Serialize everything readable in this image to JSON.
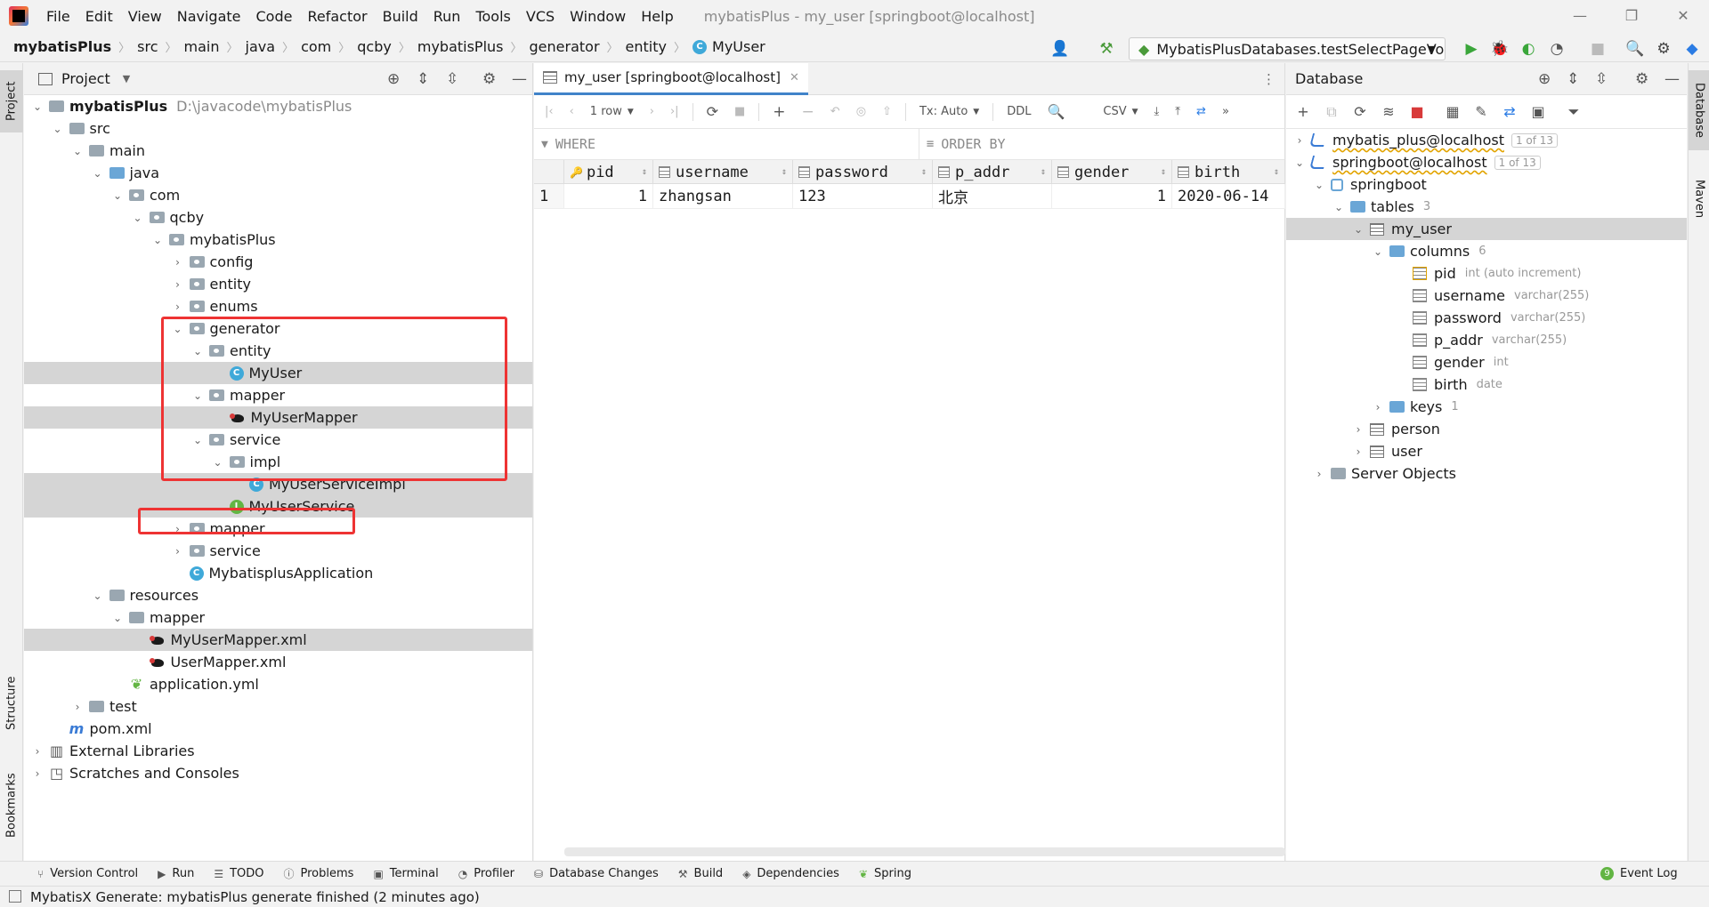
{
  "menu": [
    "File",
    "Edit",
    "View",
    "Navigate",
    "Code",
    "Refactor",
    "Build",
    "Run",
    "Tools",
    "VCS",
    "Window",
    "Help"
  ],
  "window_title": "mybatisPlus - my_user [springboot@localhost]",
  "breadcrumb": [
    "mybatisPlus",
    "src",
    "main",
    "java",
    "com",
    "qcby",
    "mybatisPlus",
    "generator",
    "entity",
    "MyUser"
  ],
  "run_config": "MybatisPlusDatabases.testSelectPageVo",
  "project": {
    "title": "Project",
    "tree": [
      {
        "label": "mybatisPlus",
        "extra": "D:\\javacode\\mybatisPlus",
        "depth": 0,
        "icon": "folder",
        "arrow": "down",
        "bold": true
      },
      {
        "label": "src",
        "depth": 1,
        "icon": "folder",
        "arrow": "down"
      },
      {
        "label": "main",
        "depth": 2,
        "icon": "folder",
        "arrow": "down"
      },
      {
        "label": "java",
        "depth": 3,
        "icon": "folder-blue",
        "arrow": "down"
      },
      {
        "label": "com",
        "depth": 4,
        "icon": "package",
        "arrow": "down"
      },
      {
        "label": "qcby",
        "depth": 5,
        "icon": "package",
        "arrow": "down"
      },
      {
        "label": "mybatisPlus",
        "depth": 6,
        "icon": "package",
        "arrow": "down"
      },
      {
        "label": "config",
        "depth": 7,
        "icon": "package",
        "arrow": "right"
      },
      {
        "label": "entity",
        "depth": 7,
        "icon": "package",
        "arrow": "right"
      },
      {
        "label": "enums",
        "depth": 7,
        "icon": "package",
        "arrow": "right"
      },
      {
        "label": "generator",
        "depth": 7,
        "icon": "package",
        "arrow": "down"
      },
      {
        "label": "entity",
        "depth": 8,
        "icon": "package",
        "arrow": "down"
      },
      {
        "label": "MyUser",
        "depth": 9,
        "icon": "class",
        "arrow": "none",
        "selected": true
      },
      {
        "label": "mapper",
        "depth": 8,
        "icon": "package",
        "arrow": "down"
      },
      {
        "label": "MyUserMapper",
        "depth": 9,
        "icon": "mybatis",
        "arrow": "none",
        "selected": true
      },
      {
        "label": "service",
        "depth": 8,
        "icon": "package",
        "arrow": "down"
      },
      {
        "label": "impl",
        "depth": 9,
        "icon": "package",
        "arrow": "down"
      },
      {
        "label": "MyUserServiceImpl",
        "depth": 10,
        "icon": "class",
        "arrow": "none",
        "selected": true
      },
      {
        "label": "MyUserService",
        "depth": 9,
        "icon": "interface",
        "arrow": "none",
        "selected": true
      },
      {
        "label": "mapper",
        "depth": 7,
        "icon": "package",
        "arrow": "right"
      },
      {
        "label": "service",
        "depth": 7,
        "icon": "package",
        "arrow": "right"
      },
      {
        "label": "MybatisplusApplication",
        "depth": 7,
        "icon": "class",
        "arrow": "none"
      },
      {
        "label": "resources",
        "depth": 3,
        "icon": "folder",
        "arrow": "down"
      },
      {
        "label": "mapper",
        "depth": 4,
        "icon": "folder",
        "arrow": "down"
      },
      {
        "label": "MyUserMapper.xml",
        "depth": 5,
        "icon": "mybatis",
        "arrow": "none",
        "selected": true
      },
      {
        "label": "UserMapper.xml",
        "depth": 5,
        "icon": "mybatis",
        "arrow": "none"
      },
      {
        "label": "application.yml",
        "depth": 4,
        "icon": "yml",
        "arrow": "none"
      },
      {
        "label": "test",
        "depth": 2,
        "icon": "folder",
        "arrow": "right"
      },
      {
        "label": "pom.xml",
        "depth": 1,
        "icon": "maven",
        "arrow": "none"
      },
      {
        "label": "External Libraries",
        "depth": 0,
        "icon": "library",
        "arrow": "right"
      },
      {
        "label": "Scratches and Consoles",
        "depth": 0,
        "icon": "scratch",
        "arrow": "right"
      }
    ]
  },
  "editor": {
    "tab_label": "my_user [springboot@localhost]",
    "row_count": "1 row",
    "tx_mode": "Tx: Auto",
    "ddl": "DDL",
    "export_format": "CSV",
    "where_placeholder": "WHERE",
    "orderby_placeholder": "ORDER BY",
    "columns": [
      "pid",
      "username",
      "password",
      "p_addr",
      "gender",
      "birth"
    ],
    "rows": [
      {
        "n": "1",
        "pid": "1",
        "username": "zhangsan",
        "password": "123",
        "p_addr": "北京",
        "gender": "1",
        "birth": "2020-06-14"
      }
    ]
  },
  "database": {
    "title": "Database",
    "connections": [
      {
        "label": "mybatis_plus@localhost",
        "badge": "1 of 13"
      },
      {
        "label": "springboot@localhost",
        "badge": "1 of 13"
      }
    ],
    "schema": "springboot",
    "tables_label": "tables",
    "tables_count": "3",
    "active_table": "my_user",
    "columns_label": "columns",
    "columns_count": "6",
    "columns": [
      {
        "name": "pid",
        "type": "int (auto increment)",
        "key": true
      },
      {
        "name": "username",
        "type": "varchar(255)"
      },
      {
        "name": "password",
        "type": "varchar(255)"
      },
      {
        "name": "p_addr",
        "type": "varchar(255)"
      },
      {
        "name": "gender",
        "type": "int"
      },
      {
        "name": "birth",
        "type": "date"
      }
    ],
    "keys_label": "keys",
    "keys_count": "1",
    "other_tables": [
      "person",
      "user"
    ],
    "server_objects": "Server Objects"
  },
  "side_tabs": {
    "left": [
      "Project",
      "Structure",
      "Bookmarks"
    ],
    "right": [
      "Database",
      "Maven"
    ]
  },
  "bottom_tabs": [
    "Version Control",
    "Run",
    "TODO",
    "Problems",
    "Terminal",
    "Profiler",
    "Database Changes",
    "Build",
    "Dependencies",
    "Spring"
  ],
  "event_log": "Event Log",
  "event_log_count": "9",
  "status": "MybatisX Generate: mybatisPlus generate finished (2 minutes ago)",
  "colors": {
    "highlight": "#ee3333",
    "selection": "#d5d5d5",
    "accent": "#4083c9"
  }
}
